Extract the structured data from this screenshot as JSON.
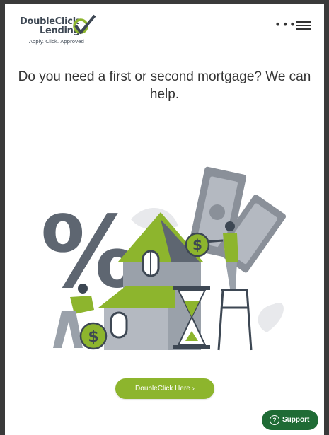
{
  "brand": {
    "name_line1": "DoubleClick",
    "name_line2": "Lending",
    "tagline": "Apply. Click. Approved",
    "accent_color": "#8db52d"
  },
  "header": {
    "more_icon": "more-dots-icon",
    "menu_icon": "hamburger-icon",
    "more_label": "•••"
  },
  "main": {
    "headline": "Do you need a first or second mortgage? We can help.",
    "illustration": "house-mortgage-illustration",
    "percent_sign": "%",
    "coin_symbol": "$"
  },
  "cta": {
    "label": "DoubleClick Here ›"
  },
  "support": {
    "label": "Support",
    "icon": "question-icon",
    "icon_glyph": "?",
    "color": "#1f6b35"
  }
}
